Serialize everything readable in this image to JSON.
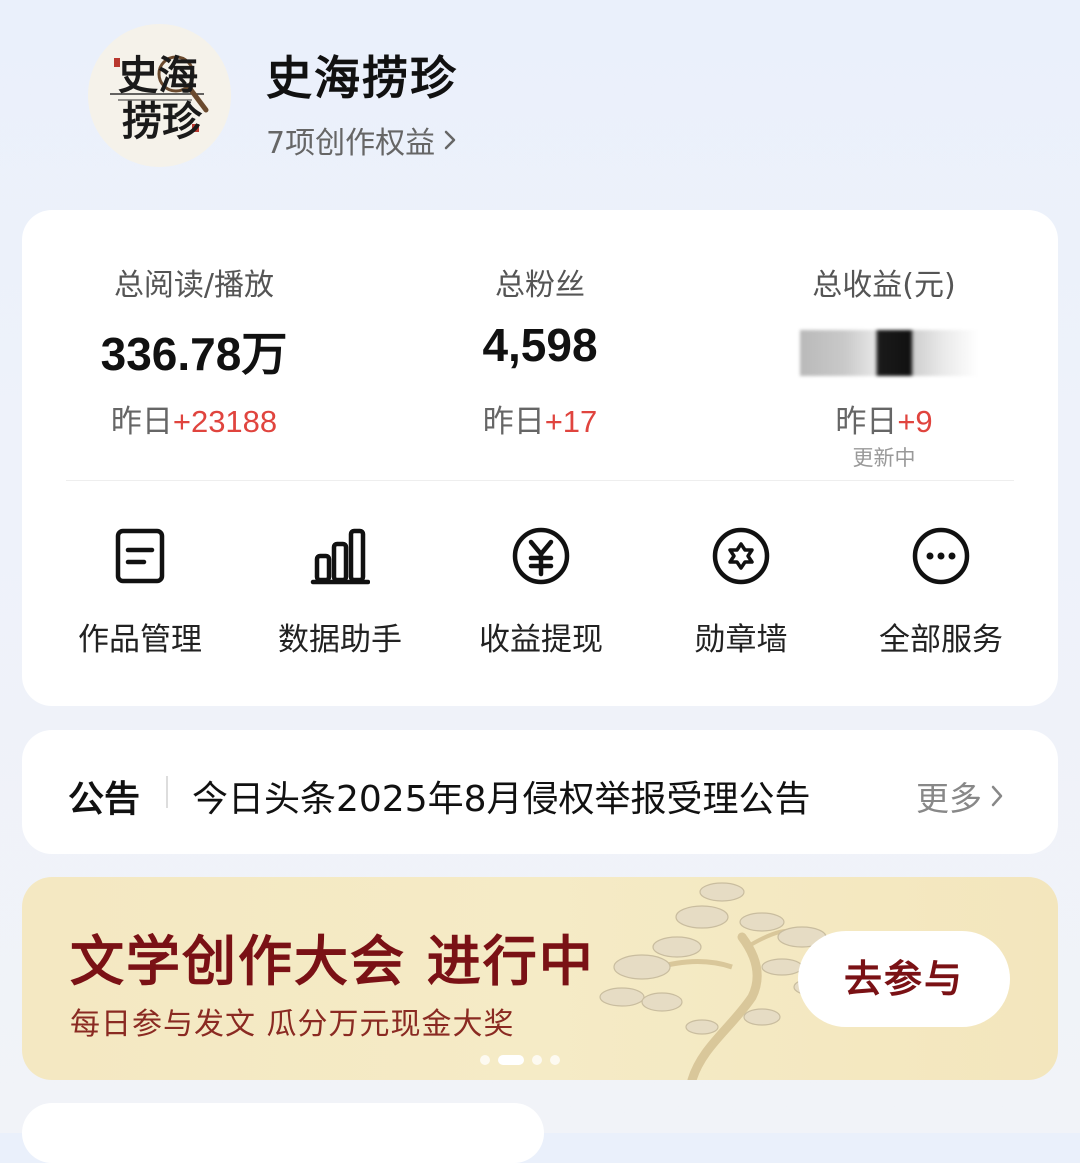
{
  "profile": {
    "logo_line1": "史海",
    "logo_line2": "捞珍",
    "name": "史海捞珍",
    "rights_link": "7项创作权益"
  },
  "stats": [
    {
      "label": "总阅读/播放",
      "value": "336.78万",
      "delta_prefix": "昨日",
      "delta": "+23188"
    },
    {
      "label": "总粉丝",
      "value": "4,598",
      "delta_prefix": "昨日",
      "delta": "+17"
    },
    {
      "label": "总收益(元)",
      "value": "",
      "delta_prefix": "昨日",
      "delta": "+9",
      "status": "更新中"
    }
  ],
  "services": [
    {
      "label": "作品管理",
      "icon": "document-icon"
    },
    {
      "label": "数据助手",
      "icon": "bar-chart-icon"
    },
    {
      "label": "收益提现",
      "icon": "yuan-icon"
    },
    {
      "label": "勋章墙",
      "icon": "medal-icon"
    },
    {
      "label": "全部服务",
      "icon": "more-icon"
    }
  ],
  "notice": {
    "tag": "公告",
    "text": "今日头条2025年8月侵权举报受理公告",
    "more": "更多"
  },
  "banner": {
    "title": "文学创作大会 进行中",
    "subtitle": "每日参与发文 瓜分万元现金大奖",
    "button": "去参与",
    "active_slide": 2,
    "slide_count": 4
  },
  "colors": {
    "accent_red": "#e0443e",
    "banner_bg": "#f4e8c2",
    "banner_text": "#7a1115"
  }
}
